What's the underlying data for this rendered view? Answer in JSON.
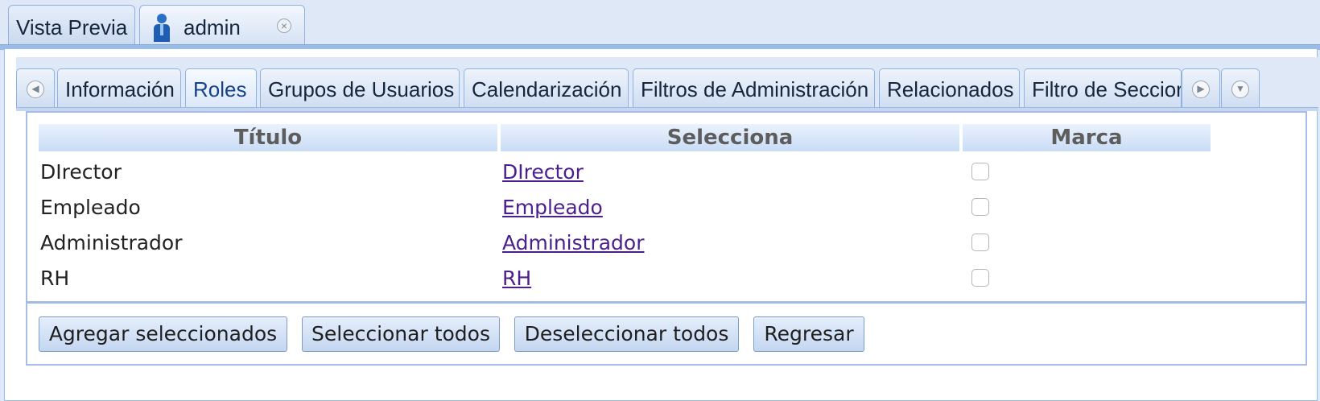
{
  "top_tabs": [
    {
      "label": "Vista Previa"
    },
    {
      "label": "admin",
      "icon": "user-icon"
    }
  ],
  "inner_tabs": [
    {
      "label": "Información"
    },
    {
      "label": "Roles",
      "active": true
    },
    {
      "label": "Grupos de Usuarios"
    },
    {
      "label": "Calendarización"
    },
    {
      "label": "Filtros de Administración"
    },
    {
      "label": "Relacionados"
    },
    {
      "label": "Filtro de Seccior"
    }
  ],
  "grid": {
    "columns": [
      "Título",
      "Selecciona",
      "Marca"
    ],
    "rows": [
      {
        "title": "DIrector",
        "link": "DIrector",
        "checked": false
      },
      {
        "title": "Empleado",
        "link": "Empleado",
        "checked": false
      },
      {
        "title": "Administrador",
        "link": "Administrador",
        "checked": false
      },
      {
        "title": "RH",
        "link": "RH",
        "checked": false
      }
    ]
  },
  "buttons": {
    "add_selected": "Agregar seleccionados",
    "select_all": "Seleccionar todos",
    "deselect_all": "Deseleccionar todos",
    "back": "Regresar"
  },
  "colors": {
    "background": "#dfe8f6",
    "tab_border": "#8db2e3",
    "link": "#4b1f8e"
  }
}
